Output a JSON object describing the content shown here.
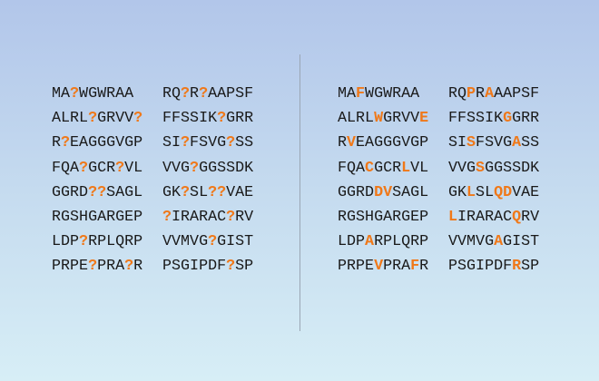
{
  "divider_color": "#9aa6b4",
  "highlight_color": "#f07818",
  "left_panel": {
    "rows": [
      [
        "MA?WGWRAA",
        "RQ?R?AAPSF"
      ],
      [
        "ALRL?GRVV?",
        "FFSSIK?GRR"
      ],
      [
        "R?EAGGGVGP",
        "SI?FSVG?SS"
      ],
      [
        "FQA?GCR?VL",
        "VVG?GGSSDK"
      ],
      [
        "GGRD??SAGL",
        "GK?SL??VAE"
      ],
      [
        "RGSHGARGEP",
        "?IRARAC?RV"
      ],
      [
        "LDP?RPLQRP",
        "VVMVG?GIST"
      ],
      [
        "PRPE?PRA?R",
        "PSGIPDF?SP"
      ]
    ]
  },
  "right_panel": {
    "rows": [
      [
        "MAFWGWRAA",
        "RQPRAAAPSF"
      ],
      [
        "ALRLWGRVVE",
        "FFSSIKGGRR"
      ],
      [
        "RVEAGGGVGP",
        "SISFSVGASS"
      ],
      [
        "FQACGCRLVL",
        "VVGSGGSSDK"
      ],
      [
        "GGRDDVSAGL",
        "GKLSLQDVAE"
      ],
      [
        "RGSHGARGEP",
        "LIRARACQRV"
      ],
      [
        "LDPARPLQRP",
        "VVMVGAGIST"
      ],
      [
        "PRPEVPRAFR",
        "PSGIPDFRSP"
      ]
    ],
    "highlight_positions": [
      [
        [
          2
        ],
        [
          2,
          4
        ]
      ],
      [
        [
          4,
          9
        ],
        [
          6
        ]
      ],
      [
        [
          1
        ],
        [
          2,
          7
        ]
      ],
      [
        [
          3,
          7
        ],
        [
          3
        ]
      ],
      [
        [
          4,
          5
        ],
        [
          2,
          5,
          6
        ]
      ],
      [
        [],
        [
          0,
          7
        ]
      ],
      [
        [
          3
        ],
        [
          5
        ]
      ],
      [
        [
          4,
          8
        ],
        [
          7
        ]
      ]
    ]
  }
}
